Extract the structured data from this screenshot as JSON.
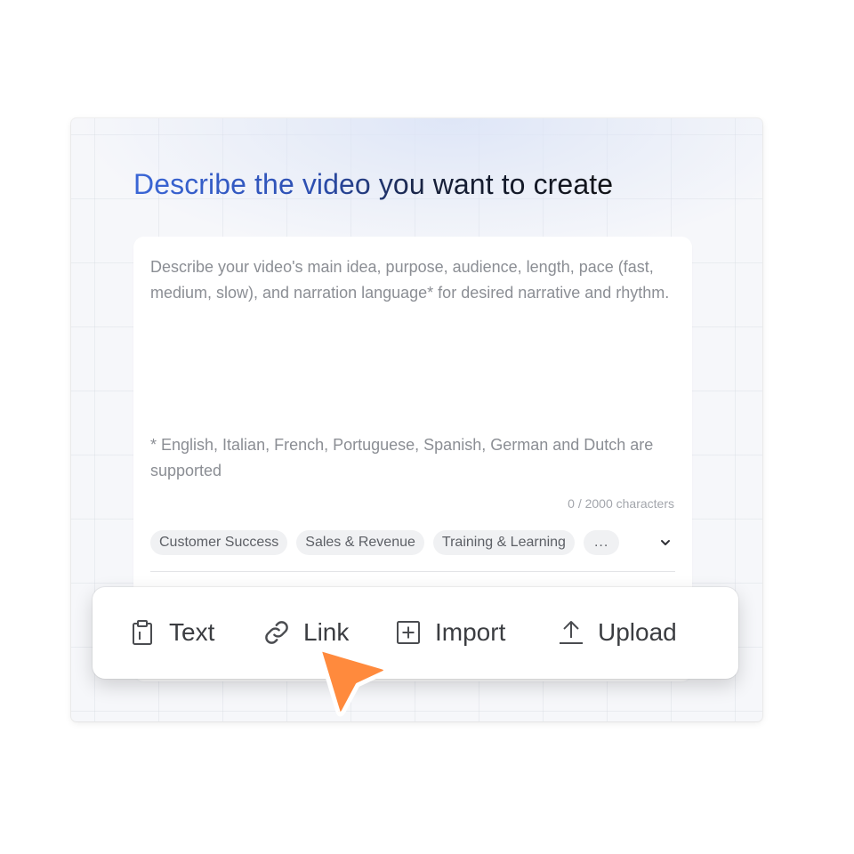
{
  "header": {
    "title": "Describe the video you want to create"
  },
  "prompt": {
    "placeholder": "Describe your video's main idea, purpose, audience, length, pace (fast, medium, slow), and narration language* for desired narrative and rhythm.",
    "value": "",
    "languages_note": "* English, Italian, French, Portuguese, Spanish, German and Dutch are supported",
    "char_count": "0 / 2000 characters"
  },
  "tags": [
    {
      "label": "Customer Success"
    },
    {
      "label": "Sales & Revenue"
    },
    {
      "label": "Training & Learning"
    },
    {
      "label": "..."
    }
  ],
  "toolbar": {
    "items": [
      {
        "label": "Text",
        "icon": "clipboard-icon"
      },
      {
        "label": "Link",
        "icon": "link-icon"
      },
      {
        "label": "Import",
        "icon": "plus-square-icon"
      },
      {
        "label": "Upload",
        "icon": "upload-icon"
      }
    ]
  },
  "colors": {
    "title_gradient_start": "#3a66d6",
    "title_gradient_end": "#111317",
    "cursor": "#ff8a3d"
  }
}
